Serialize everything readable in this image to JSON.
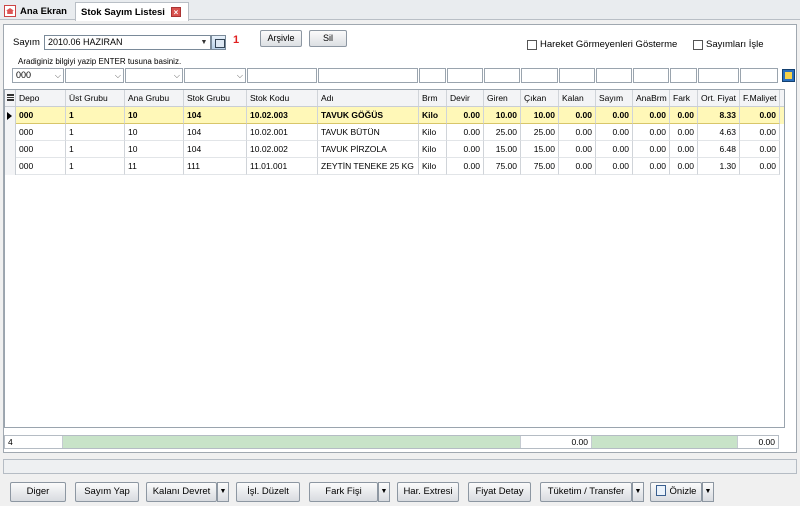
{
  "tabs": [
    {
      "label": "Ana Ekran"
    },
    {
      "label": "Stok Sayım Listesi"
    }
  ],
  "header": {
    "sayim_label": "Sayım",
    "sayim_value": "2010.06 HAZIRAN",
    "counter": "1",
    "arsivle_label": "Arşivle",
    "sil_label": "Sil",
    "chk_hareket": "Hareket Görmeyenleri Gösterme",
    "chk_sayim": "Sayımları İşle",
    "hint": "Aradiginiz bilgiyi yazip ENTER tusuna basiniz."
  },
  "filters": {
    "depo_value": "000"
  },
  "grid": {
    "columns": [
      "Depo",
      "Üst Grubu",
      "Ana Grubu",
      "Stok Grubu",
      "Stok Kodu",
      "Adı",
      "Brm",
      "Devir",
      "Giren",
      "Çıkan",
      "Kalan",
      "Sayım",
      "AnaBrm",
      "Fark",
      "Ort. Fiyat",
      "F.Maliyet"
    ],
    "rows": [
      [
        "000",
        "1",
        "10",
        "104",
        "10.02.003",
        "TAVUK GÖĞÜS",
        "Kilo",
        "0.00",
        "10.00",
        "10.00",
        "0.00",
        "0.00",
        "0.00",
        "0.00",
        "8.33",
        "0.00"
      ],
      [
        "000",
        "1",
        "10",
        "104",
        "10.02.001",
        "TAVUK BÜTÜN",
        "Kilo",
        "0.00",
        "25.00",
        "25.00",
        "0.00",
        "0.00",
        "0.00",
        "0.00",
        "4.63",
        "0.00"
      ],
      [
        "000",
        "1",
        "10",
        "104",
        "10.02.002",
        "TAVUK PİRZOLA",
        "Kilo",
        "0.00",
        "15.00",
        "15.00",
        "0.00",
        "0.00",
        "0.00",
        "0.00",
        "6.48",
        "0.00"
      ],
      [
        "000",
        "1",
        "11",
        "111",
        "11.01.001",
        "ZEYTİN TENEKE 25 KG",
        "Kilo",
        "0.00",
        "75.00",
        "75.00",
        "0.00",
        "0.00",
        "0.00",
        "0.00",
        "1.30",
        "0.00"
      ]
    ]
  },
  "footer": {
    "count": "4",
    "kalan_total": "0.00",
    "maliyet_total": "0.00"
  },
  "buttons": {
    "diger": "Diger",
    "sayim_yap": "Sayım Yap",
    "kalani_devret": "Kalanı Devret",
    "isl_duzelt": "İşl. Düzelt",
    "fark_fisi": "Fark Fişi",
    "har_extresi": "Har. Extresi",
    "fiyat_detay": "Fiyat Detay",
    "tuketim_transfer": "Tüketim / Transfer",
    "onizle": "Önizle"
  },
  "colors": {
    "selected_row": "#fff8b8",
    "footer_green": "#c8e3c8",
    "counter_red": "#e02020"
  }
}
